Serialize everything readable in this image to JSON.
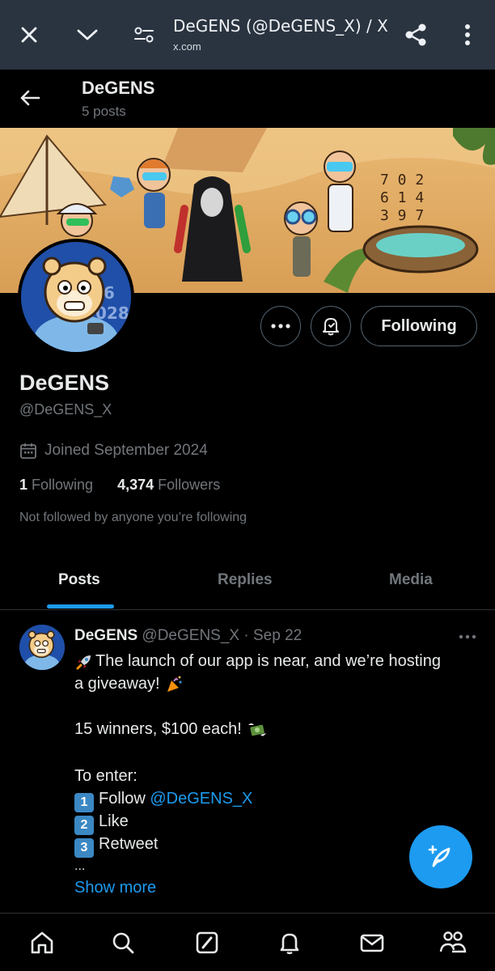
{
  "browser": {
    "title": "DeGENS (@DeGENS_X) / X",
    "url": "x.com",
    "icons": [
      "close-icon",
      "chevron-down-icon",
      "page-settings-icon",
      "share-icon",
      "more-vertical-icon"
    ]
  },
  "header": {
    "name": "DeGENS",
    "posts_count": "5 posts"
  },
  "profile": {
    "name": "DeGENS",
    "handle": "@DeGENS_X",
    "joined": "Joined September 2024",
    "following_count": "1",
    "following_label": "Following",
    "followers_count": "4,374",
    "followers_label": "Followers",
    "not_followed": "Not followed by anyone you’re following",
    "follow_button": "Following"
  },
  "tabs": [
    {
      "label": "Posts",
      "active": true
    },
    {
      "label": "Replies",
      "active": false
    },
    {
      "label": "Media",
      "active": false
    }
  ],
  "post": {
    "author_name": "DeGENS",
    "author_handle": "@DeGENS_X",
    "separator": "·",
    "date": "Sep 22",
    "line1": "The launch of our app is near, and we’re hosting",
    "line2": "a giveaway!",
    "line3": "15 winners, $100 each!",
    "line4": "To enter:",
    "step1_num": "1",
    "step1_text": "Follow",
    "step1_mention": "@DeGENS_X",
    "step2_num": "2",
    "step2_text": "Like",
    "step3_num": "3",
    "step3_text": "Retweet",
    "ellipsis": "...",
    "show_more": "Show more"
  },
  "colors": {
    "accent": "#1d9bf0",
    "background": "#000000",
    "browser_bar": "#2a3440",
    "secondary_text": "#71767b"
  },
  "bottom_nav": [
    "home-icon",
    "search-icon",
    "grok-icon",
    "notifications-icon",
    "messages-icon",
    "communities-icon"
  ]
}
